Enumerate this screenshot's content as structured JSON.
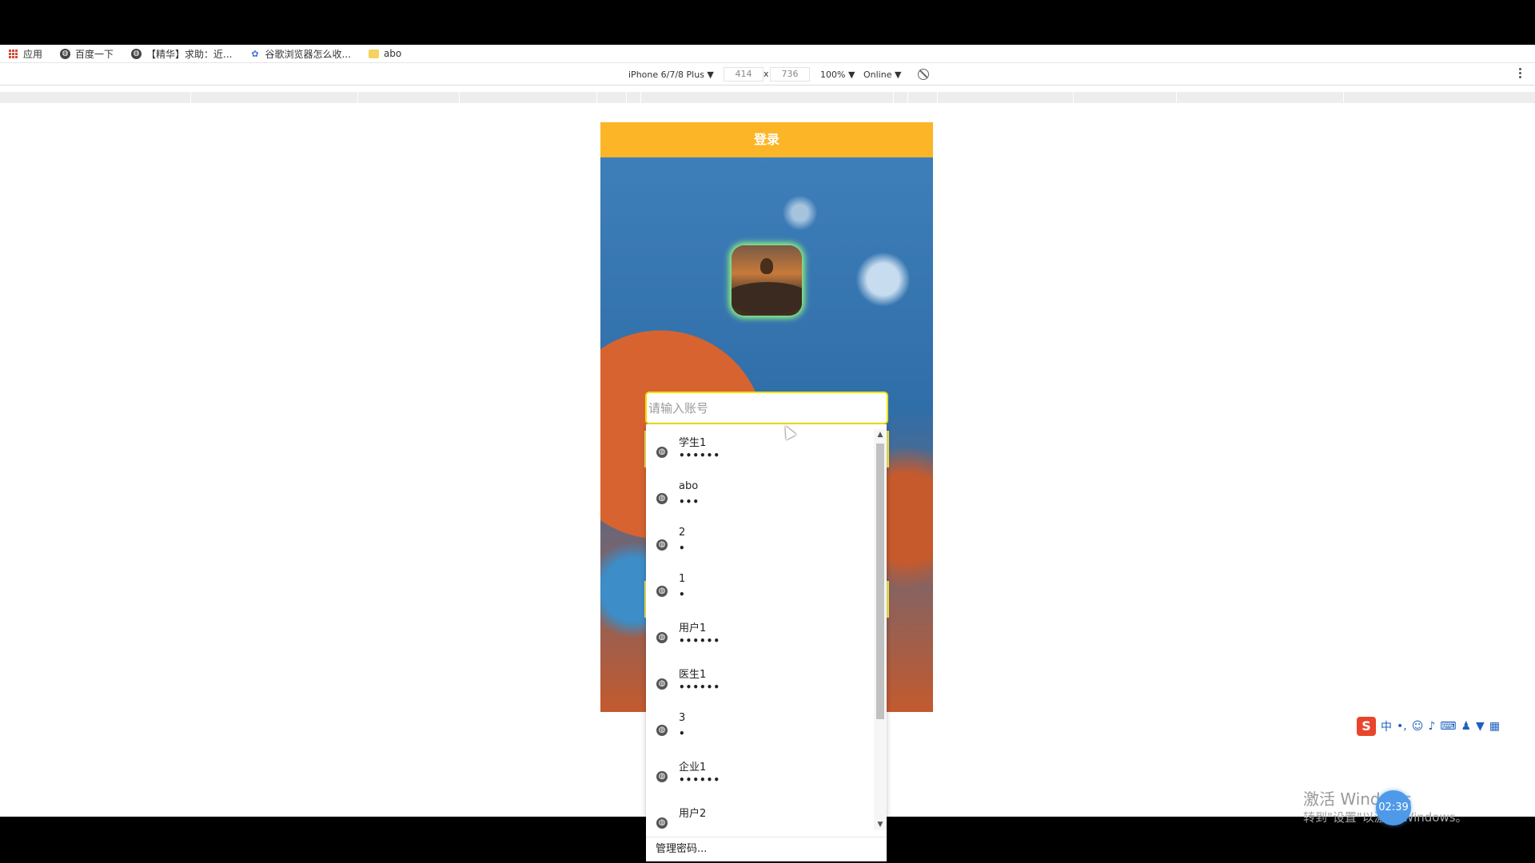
{
  "bookmarks": {
    "items": [
      {
        "label": "应用",
        "icon": "apps-grid-icon"
      },
      {
        "label": "百度一下",
        "icon": "globe-icon"
      },
      {
        "label": "【精华】求助：近...",
        "icon": "globe-icon"
      },
      {
        "label": "谷歌浏览器怎么收...",
        "icon": "paw-icon"
      },
      {
        "label": "abo",
        "icon": "folder-icon"
      }
    ]
  },
  "device_toolbar": {
    "device": "iPhone 6/7/8 Plus ▼",
    "width": "414",
    "times": "x",
    "height": "736",
    "zoom": "100% ▼",
    "network": "Online ▼"
  },
  "app": {
    "header_title": "登录",
    "account_placeholder": "请输入账号"
  },
  "autofill": {
    "entries": [
      {
        "user": "学生1",
        "password": "••••••"
      },
      {
        "user": "abo",
        "password": "•••"
      },
      {
        "user": "2",
        "password": "•"
      },
      {
        "user": "1",
        "password": "•"
      },
      {
        "user": "用户1",
        "password": "••••••"
      },
      {
        "user": "医生1",
        "password": "••••••"
      },
      {
        "user": "3",
        "password": "•"
      },
      {
        "user": "企业1",
        "password": "••••••"
      },
      {
        "user": "用户2",
        "password": ""
      }
    ],
    "manage_label": "管理密码..."
  },
  "ime": {
    "brand": "S",
    "mode": "中",
    "punct": "•,",
    "icons": [
      "smiley-icon",
      "mic-icon",
      "keyboard-icon",
      "skin-icon",
      "shirt-icon",
      "grid-icon"
    ]
  },
  "watermark": {
    "line1": "激活 Windows",
    "line2": "转到\"设置\"以激活 Windows。",
    "timer": "02:39"
  },
  "colors": {
    "header": "#fbb526",
    "input_border": "#f3e000",
    "avatar_glow": "#9aff7a"
  }
}
